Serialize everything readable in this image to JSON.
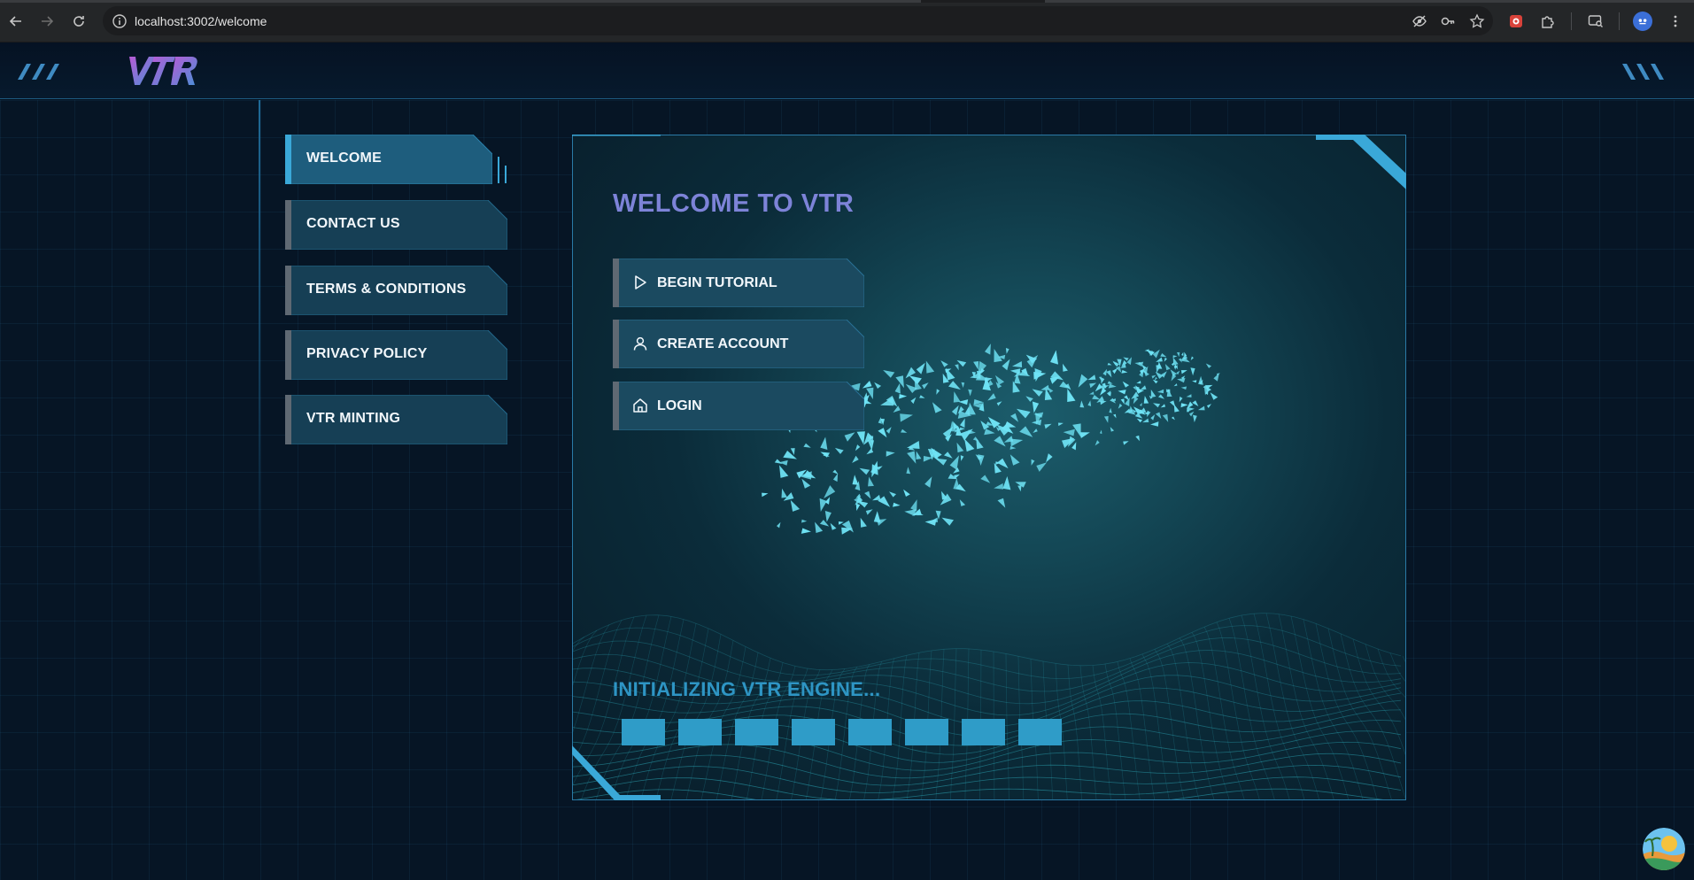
{
  "browser": {
    "url": "localhost:3002/welcome",
    "icons": [
      "back-icon",
      "forward-icon",
      "reload-icon",
      "site-info-icon",
      "eye-off-icon",
      "key-icon",
      "star-icon",
      "extension-icon",
      "puzzle-icon",
      "tab-search-icon",
      "profile-icon",
      "menu-icon"
    ]
  },
  "header": {
    "logo_text": "VTR"
  },
  "sidebar": {
    "items": [
      {
        "label": "WELCOME",
        "active": true
      },
      {
        "label": "CONTACT US",
        "active": false
      },
      {
        "label": "TERMS & CONDITIONS",
        "active": false
      },
      {
        "label": "PRIVACY POLICY",
        "active": false
      },
      {
        "label": "VTR MINTING",
        "active": false
      }
    ]
  },
  "main": {
    "title": "WELCOME TO VTR",
    "actions": [
      {
        "label": "BEGIN TUTORIAL",
        "icon": "play-icon"
      },
      {
        "label": "CREATE ACCOUNT",
        "icon": "user-icon"
      },
      {
        "label": "LOGIN",
        "icon": "home-icon"
      }
    ],
    "status_text": "INITIALIZING VTR ENGINE...",
    "progress_blocks": 8
  },
  "colors": {
    "accent": "#2f9cc8",
    "title": "#7d83d8",
    "background": "#061525",
    "button_fill": "#1b4a60"
  }
}
